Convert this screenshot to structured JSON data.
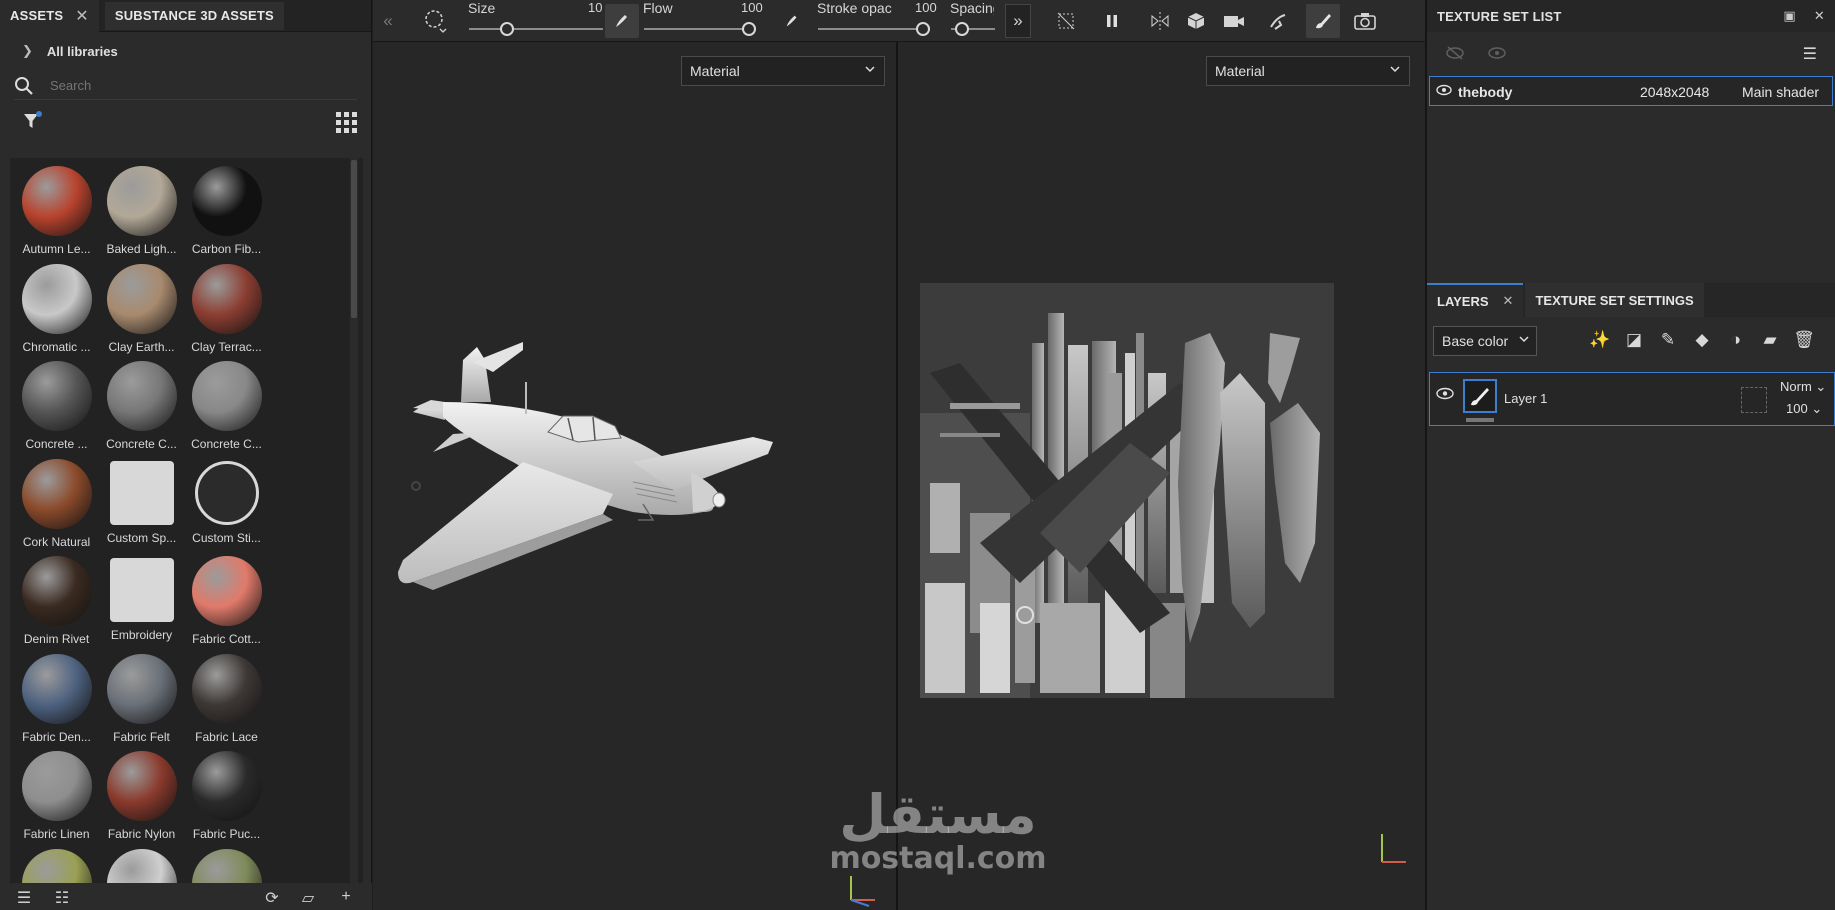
{
  "assets_panel": {
    "tab_assets": "ASSETS",
    "tab_substance": "SUBSTANCE 3D ASSETS",
    "libraries_label": "All libraries",
    "search_placeholder": "Search",
    "items": [
      {
        "label": "Autumn Le...",
        "color": "#b8432e"
      },
      {
        "label": "Baked Ligh...",
        "color": "#b2a897"
      },
      {
        "label": "Carbon Fib...",
        "color": "#111111"
      },
      {
        "label": "Chromatic ...",
        "color": "#c8c8c8"
      },
      {
        "label": "Clay Earth...",
        "color": "#a88a6e"
      },
      {
        "label": "Clay Terrac...",
        "color": "#8c3e32"
      },
      {
        "label": "Concrete ...",
        "color": "#555555"
      },
      {
        "label": "Concrete C...",
        "color": "#777777"
      },
      {
        "label": "Concrete C...",
        "color": "#888888"
      },
      {
        "label": "Cork Natural",
        "color": "#8b4a2b"
      },
      {
        "label": "Custom Sp...",
        "color": "#d8d8d8"
      },
      {
        "label": "Custom Sti...",
        "color": "#d8d8d8"
      },
      {
        "label": "Denim Rivet",
        "color": "#3a2a20"
      },
      {
        "label": "Embroidery",
        "color": "#d8d8d8"
      },
      {
        "label": "Fabric Cott...",
        "color": "#e07a6a"
      },
      {
        "label": "Fabric Den...",
        "color": "#4e6280"
      },
      {
        "label": "Fabric Felt",
        "color": "#6a7078"
      },
      {
        "label": "Fabric Lace",
        "color": "#3d3836"
      },
      {
        "label": "Fabric Linen",
        "color": "#8e8e8e"
      },
      {
        "label": "Fabric Nylon",
        "color": "#8a3a2c"
      },
      {
        "label": "Fabric Puc...",
        "color": "#2a2a2a"
      },
      {
        "label": "",
        "color": "#9aa054"
      },
      {
        "label": "",
        "color": "#cfcfcf"
      },
      {
        "label": "",
        "color": "#7f8a5a"
      }
    ]
  },
  "toolbar": {
    "size_label": "Size",
    "size_value": "10",
    "flow_label": "Flow",
    "flow_value": "100",
    "stroke_label": "Stroke opac",
    "stroke_value": "100",
    "spacing_label": "Spacing"
  },
  "viewports": {
    "left_mode": "Material",
    "right_mode": "Material"
  },
  "texture_set_list": {
    "title": "TEXTURE SET LIST",
    "row": {
      "name": "thebody",
      "resolution": "2048x2048",
      "shader": "Main shader"
    }
  },
  "layers": {
    "tab_layers": "LAYERS",
    "tab_settings": "TEXTURE SET SETTINGS",
    "channel": "Base color",
    "layer": {
      "name": "Layer 1",
      "blend": "Norm",
      "opacity": "100"
    }
  },
  "watermark": {
    "arabic": "مستقل",
    "latin": "mostaql.com"
  },
  "colors": {
    "accent": "#3d7ecf",
    "panel": "#2b2b2b",
    "viewport": "#272727"
  }
}
